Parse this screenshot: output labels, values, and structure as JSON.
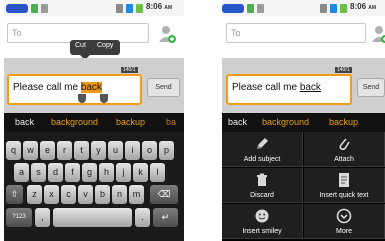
{
  "left": {
    "status_time": "8:06",
    "status_ampm": "AM",
    "to_placeholder": "To",
    "counter": "140/1",
    "compose_before": "Please call me ",
    "compose_selected": "back",
    "send_label": "Send",
    "popup": {
      "cut_label": "Cut",
      "copy_label": "Copy"
    },
    "suggestions": [
      "back",
      "background",
      "backup",
      "ba"
    ],
    "keyboard": {
      "row1": [
        "q",
        "w",
        "e",
        "r",
        "t",
        "y",
        "u",
        "i",
        "o",
        "p"
      ],
      "row2": [
        "a",
        "s",
        "d",
        "f",
        "g",
        "h",
        "j",
        "k",
        "l"
      ],
      "row3": [
        "z",
        "x",
        "c",
        "v",
        "b",
        "n",
        "m"
      ],
      "shift_label": "⇧",
      "delete_label": "⌫",
      "sym_label": "?123",
      "comma_label": ",",
      "period_label": ".",
      "enter_label": "↵"
    }
  },
  "right": {
    "status_time": "8:06",
    "status_ampm": "AM",
    "to_placeholder": "To",
    "counter": "140/1",
    "compose_before": "Please call me ",
    "compose_underlined": "back",
    "send_label": "Send",
    "suggestions": [
      "back",
      "background",
      "backup"
    ],
    "menu": [
      {
        "label": "Add subject",
        "icon": "pencil-icon"
      },
      {
        "label": "Attach",
        "icon": "paperclip-icon"
      },
      {
        "label": "Discard",
        "icon": "trash-icon"
      },
      {
        "label": "Insert quick text",
        "icon": "document-icon"
      },
      {
        "label": "Insert smiley",
        "icon": "smiley-icon"
      },
      {
        "label": "More",
        "icon": "more-icon"
      }
    ]
  },
  "colors": {
    "status_blue": "#2a55c8",
    "accent_orange": "#f39a18",
    "suggestion_orange": "#e5a21f",
    "keyboard_bg": "#1a1a1a",
    "menu_bg": "#1f1f1f"
  }
}
